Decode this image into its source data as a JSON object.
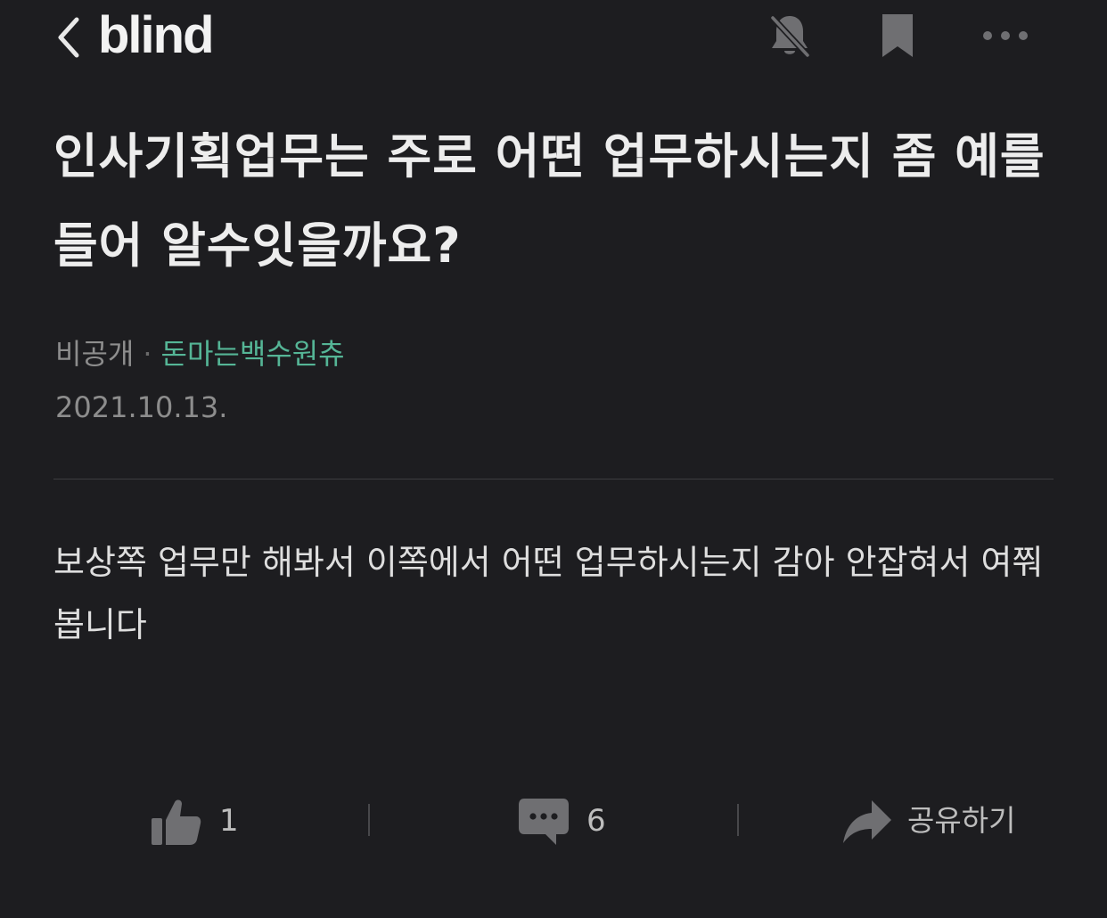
{
  "header": {
    "logo": "blind",
    "back_icon": "chevron-left-icon",
    "notification_icon": "bell-off-icon",
    "bookmark_icon": "bookmark-icon",
    "more_icon": "more-horizontal-icon"
  },
  "post": {
    "title": "인사기획업무는 주로 어떤 업무하시는지 좀 예를들어 알수잇을까요?",
    "company": "비공개",
    "separator": "·",
    "nickname": "돈마는백수원츄",
    "date": "2021.10.13.",
    "body": "보상쪽 업무만 해봐서 이쪽에서 어떤 업무하시는지 감아 안잡혀서 여쭤봅니다"
  },
  "actions": {
    "like_count": "1",
    "comment_count": "6",
    "share_label": "공유하기",
    "like_icon": "thumbs-up-icon",
    "comment_icon": "comment-icon",
    "share_icon": "share-arrow-icon"
  },
  "colors": {
    "background": "#1d1d20",
    "nickname_accent": "#55b596",
    "muted_text": "#8d8d8d"
  }
}
